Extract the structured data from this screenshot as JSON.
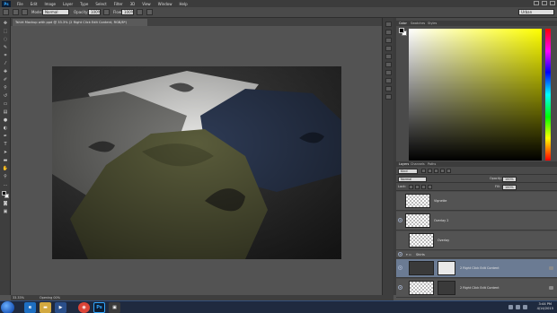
{
  "app": {
    "logo": "Ps",
    "menus": [
      "File",
      "Edit",
      "Image",
      "Layer",
      "Type",
      "Select",
      "Filter",
      "3D",
      "View",
      "Window",
      "Help"
    ]
  },
  "options_bar": {
    "mode_label": "Mode:",
    "mode_value": "Normal",
    "opacity_label": "Opacity:",
    "opacity_value": "100%",
    "flow_label": "Flow:",
    "flow_value": "100%",
    "workspace": "Urban"
  },
  "document": {
    "tab_title": "Tshirt Mockup with ppd @ 33.3% (2 Right Click Edit Content, RGB/8*)"
  },
  "status": {
    "zoom": "33.33%",
    "doc_info": "Opening 00%"
  },
  "color_panel": {
    "tabs": [
      "Color",
      "Swatches",
      "Styles"
    ],
    "foreground": "#000000",
    "background": "#ffffff"
  },
  "layers_panel": {
    "tabs": [
      "Layers",
      "Channels",
      "Paths"
    ],
    "kind_filter": "Kind",
    "blend_mode": "Normal",
    "opacity_label": "Opacity:",
    "opacity_value": "100%",
    "lock_label": "Lock:",
    "fill_label": "Fill:",
    "fill_value": "100%",
    "layers": [
      {
        "name": "Vignette",
        "selected": false,
        "visible": false
      },
      {
        "name": "Overlay 2",
        "selected": false,
        "visible": true
      },
      {
        "name": "Overlay",
        "selected": false,
        "visible": false
      },
      {
        "name": "Shirts",
        "selected": false,
        "visible": true,
        "group": true
      },
      {
        "name": "2 Right Click Edit Content",
        "selected": true,
        "visible": true
      },
      {
        "name": "2 Right Click Edit Content",
        "selected": false,
        "visible": true
      },
      {
        "name": "2 Right Click Edit Content",
        "selected": false,
        "visible": true
      }
    ]
  },
  "taskbar": {
    "time": "3:44 PM",
    "date": "4/14/2015",
    "ps_label": "Ps"
  },
  "colors": {
    "shirt_white": "#e9e9e7",
    "shirt_grey": "#7b7b78",
    "shirt_navy": "#2e3b55",
    "shirt_olive": "#5a5c3b",
    "selection": "#6b7b93"
  }
}
